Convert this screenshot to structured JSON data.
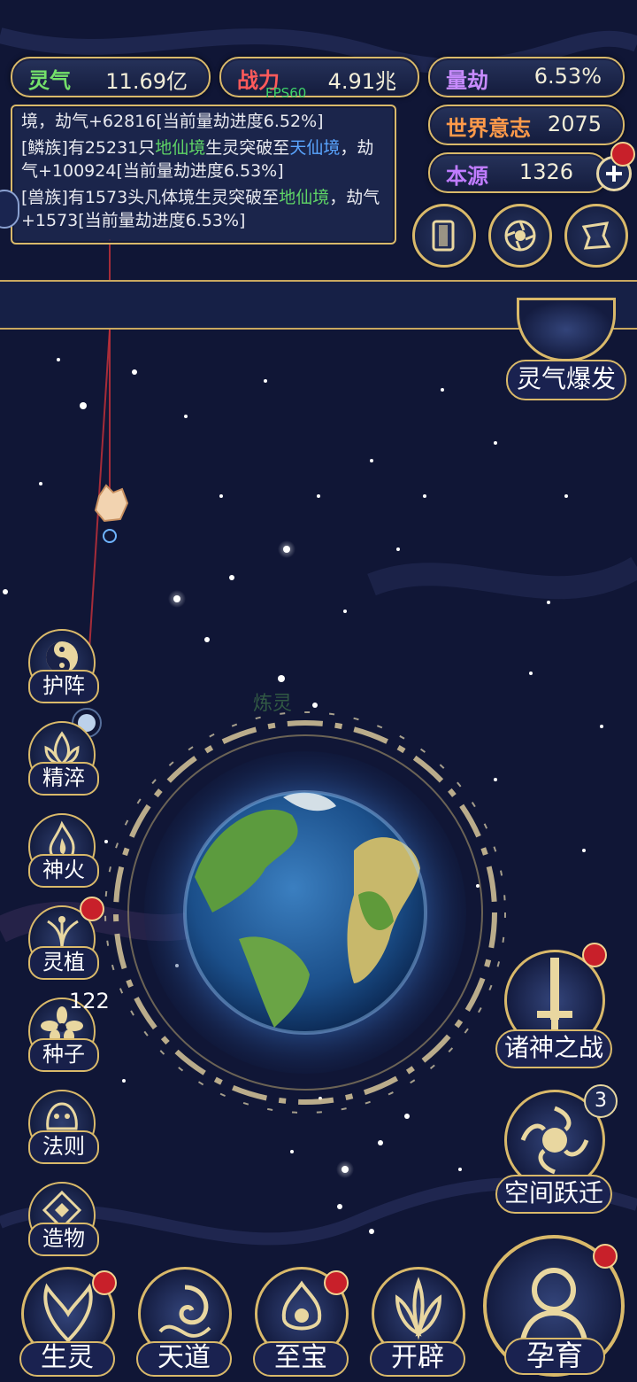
{
  "stats": {
    "lingqi": {
      "label": "灵气",
      "value": "11.69亿",
      "color": "#74e06a"
    },
    "zhanli": {
      "label": "战力",
      "value": "4.91兆",
      "color": "#ff5a5a"
    },
    "liangjie": {
      "label": "量劫",
      "value": "6.53%",
      "color": "#c98cff"
    },
    "shijie": {
      "label": "世界意志",
      "value": "2075",
      "color": "#ff9a4a"
    },
    "benyuan": {
      "label": "本源",
      "value": "1326",
      "color": "#c07cff"
    }
  },
  "fps": "FPS60",
  "log": {
    "line1": "境，劫气+62816[当前量劫进度6.52%]",
    "entry2": {
      "a": "[鳞族]有25231只",
      "b": "地仙境",
      "c": "生灵突破至",
      "d": "天仙",
      "e": "境",
      "f": "，劫气+100924[当前量劫进度6.53%]"
    },
    "entry3": {
      "a": "[兽族]有1573头凡体境生灵突破至",
      "b": "地仙",
      "c": "境",
      "d": "，劫气+1573[当前量劫进度6.53%]"
    }
  },
  "ghost_text": "炼灵",
  "right_buttons": {
    "burst": "灵气爆发",
    "war": "诸神之战",
    "leap": "空间跃迁",
    "leap_badge": "3",
    "nurture": "孕育"
  },
  "side_buttons": [
    "护阵",
    "精淬",
    "神火",
    "灵植",
    "种子",
    "法则",
    "造物"
  ],
  "seed_count": "122",
  "bottom_buttons": [
    "生灵",
    "天道",
    "至宝",
    "开辟"
  ],
  "colors": {
    "gold": "#d9b96a",
    "bg": "#0e1433",
    "notice_red": "#c8202a"
  }
}
